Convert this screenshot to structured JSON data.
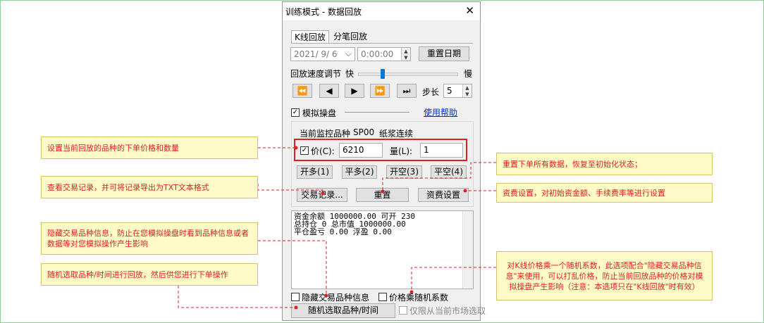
{
  "window": {
    "title": "训练模式 - 数据回放",
    "close_glyph": "✕"
  },
  "tabs": [
    {
      "label": "K线回放"
    },
    {
      "label": "分笔回放"
    }
  ],
  "date": {
    "value": "2021/ 9/ 6",
    "time": "0:00:00",
    "reset_label": "重置日期"
  },
  "speed": {
    "label": "回放速度调节",
    "fast": "快",
    "slow": "慢",
    "level": 0.24
  },
  "playback": {
    "buttons": [
      "⏪",
      "◀",
      "▶",
      "⏩",
      "⏭"
    ],
    "step_label": "步长",
    "step_value": "5"
  },
  "sim": {
    "checkbox_label": "模拟操盘",
    "checked": true,
    "help_link": "使用帮助"
  },
  "monitor": {
    "label": "当前监控品种",
    "code": "SP00",
    "name": "纸浆连续"
  },
  "order": {
    "price_checked": true,
    "price_label": "价(C):",
    "price_value": "6210",
    "qty_label": "量(L):",
    "qty_value": "1"
  },
  "trade_buttons": [
    "开多(1)",
    "平多(2)",
    "开空(3)",
    "平空(4)"
  ],
  "action_buttons": {
    "log": "交易记录...",
    "reset": "重置",
    "fees": "资费设置"
  },
  "account_lines": [
    "资金余额 1000000.00    可开 230",
    "总持仓 0     总市值 1000000.00",
    "平仓盈亏 0.00    浮盈 0.00"
  ],
  "options": {
    "hide_label": "隐藏交易品种信息",
    "random_factor_label": "价格乘随机系数",
    "random_button": "随机选取品种/时间",
    "market_only_label": "仅限从当前市场选取"
  },
  "annotations": {
    "set_price": "设置当前回放的品种的下单价格和数量",
    "trade_log": "查看交易记录，并可将记录导出为TXT文本格式",
    "hide_info": "隐藏交易品种信息，防止在您模拟操盘时看到品种信息或者数据等对您模拟操作产生影响",
    "random_pick": "随机选取品种/时间进行回放，然后供您进行下单操作",
    "reset_orders": "重置下单所有数据，恢复至初始化状态；",
    "fee_settings": "资费设置，对初始资金额、手续费率等进行设置",
    "random_factor": "对K线价格乘一个随机系数，此选项配合\"隐藏交易品种信息\"来使用，可以打乱价格，防止当前回放品种的价格对模拟操盘产生影响（注意：本选项只在\"K线回放\"时有效）"
  },
  "colors": {
    "annotation_text": "#e02020",
    "annotation_bg": "#fffbc8",
    "highlight": "#e02020",
    "link": "#0033cc"
  }
}
